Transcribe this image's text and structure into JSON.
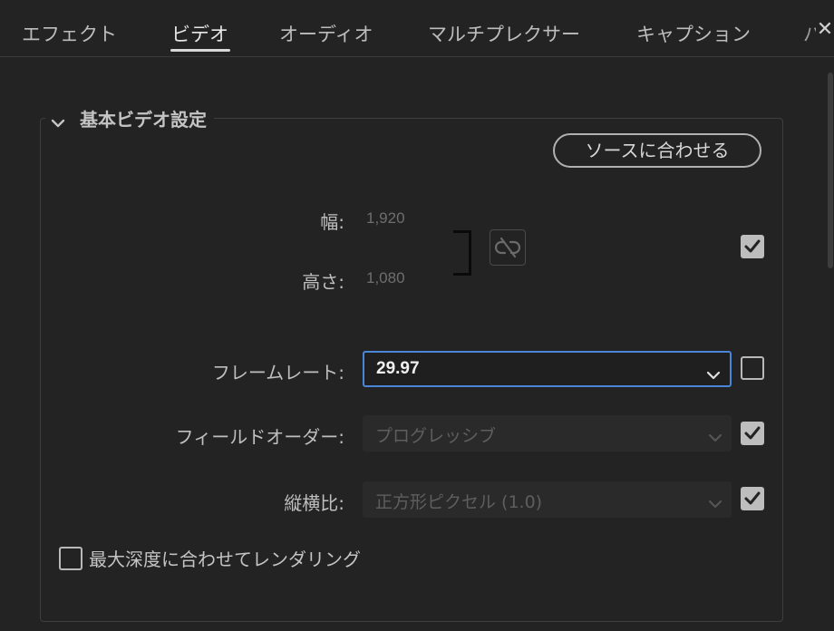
{
  "tabs": [
    {
      "label": "エフェクト",
      "active": false
    },
    {
      "label": "ビデオ",
      "active": true
    },
    {
      "label": "オーディオ",
      "active": false
    },
    {
      "label": "マルチプレクサー",
      "active": false
    },
    {
      "label": "キャプション",
      "active": false
    }
  ],
  "tab_overflow_text": "パ",
  "section": {
    "title": "基本ビデオ設定",
    "expanded": true,
    "match_source_button": "ソースに合わせる",
    "width_label": "幅:",
    "width_value": "1,920",
    "height_label": "高さ:",
    "height_value": "1,080",
    "dimensions_checked": true,
    "frame_rate": {
      "label": "フレームレート:",
      "value": "29.97",
      "checked": false
    },
    "field_order": {
      "label": "フィールドオーダー:",
      "value": "プログレッシブ",
      "checked": true
    },
    "aspect": {
      "label": "縦横比:",
      "value": "正方形ピクセル (1.0)",
      "checked": true
    },
    "render_max_depth": {
      "label": "最大深度に合わせてレンダリング",
      "checked": false
    }
  },
  "colors": {
    "background": "#232323",
    "focus_border": "#4a86d8",
    "checkbox_fill": "#bdbdbd"
  }
}
